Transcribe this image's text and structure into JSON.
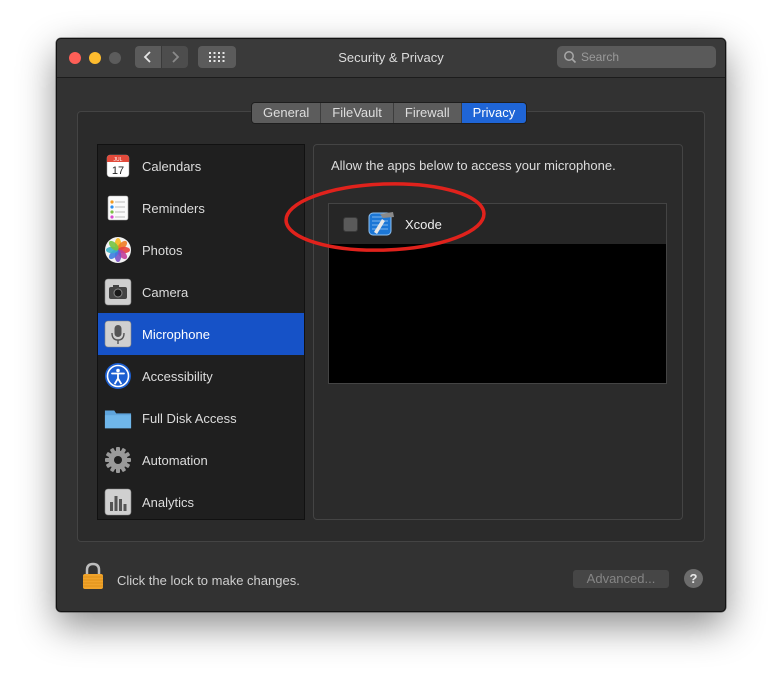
{
  "window": {
    "title": "Security & Privacy"
  },
  "search": {
    "placeholder": "Search"
  },
  "tabs": [
    {
      "label": "General",
      "active": false
    },
    {
      "label": "FileVault",
      "active": false
    },
    {
      "label": "Firewall",
      "active": false
    },
    {
      "label": "Privacy",
      "active": true
    }
  ],
  "sidebar": {
    "items": [
      {
        "label": "Calendars",
        "icon": "calendar-icon",
        "calendar_month": "JUL",
        "calendar_day": "17"
      },
      {
        "label": "Reminders",
        "icon": "reminders-icon"
      },
      {
        "label": "Photos",
        "icon": "photos-icon"
      },
      {
        "label": "Camera",
        "icon": "camera-icon"
      },
      {
        "label": "Microphone",
        "icon": "microphone-icon",
        "selected": true
      },
      {
        "label": "Accessibility",
        "icon": "accessibility-icon"
      },
      {
        "label": "Full Disk Access",
        "icon": "folder-icon"
      },
      {
        "label": "Automation",
        "icon": "gear-icon"
      },
      {
        "label": "Analytics",
        "icon": "analytics-icon"
      }
    ]
  },
  "main": {
    "description": "Allow the apps below to access your microphone.",
    "apps": [
      {
        "name": "Xcode",
        "checked": false,
        "icon": "xcode-icon"
      }
    ]
  },
  "footer": {
    "lock_text": "Click the lock to make changes.",
    "advanced_label": "Advanced...",
    "help_label": "?"
  },
  "colors": {
    "accent": "#1f65d6",
    "annotation": "#e0221c"
  }
}
